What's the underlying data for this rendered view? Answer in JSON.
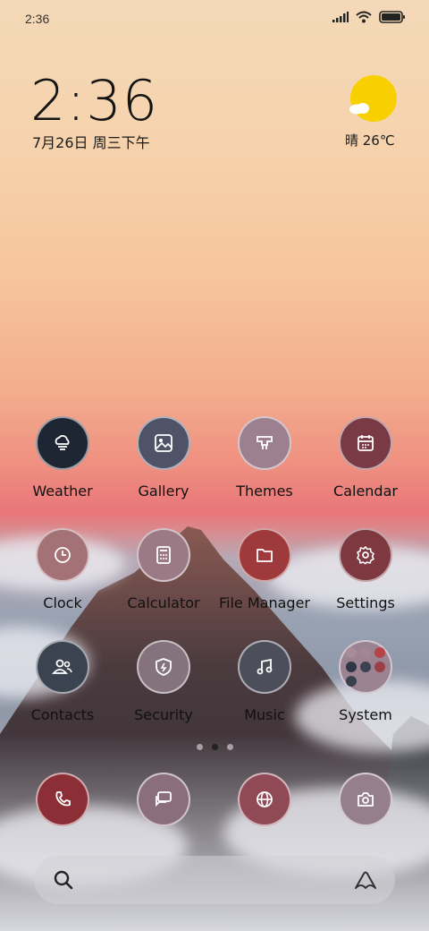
{
  "status_bar": {
    "time": "2:36"
  },
  "lock_widget": {
    "time": "2:36",
    "date": "7月26日 周三下午"
  },
  "weather_widget": {
    "text": "晴 26℃"
  },
  "apps": [
    {
      "label": "Weather",
      "icon": "weather-icon",
      "color": "#1f2633"
    },
    {
      "label": "Gallery",
      "icon": "gallery-icon",
      "color": "#4e5368"
    },
    {
      "label": "Themes",
      "icon": "themes-icon",
      "color": "#9d8090"
    },
    {
      "label": "Calendar",
      "icon": "calendar-icon",
      "color": "#7a3a45"
    },
    {
      "label": "Clock",
      "icon": "clock-icon",
      "color": "#a47276"
    },
    {
      "label": "Calculator",
      "icon": "calculator-icon",
      "color": "#9b7a86"
    },
    {
      "label": "File Manager",
      "icon": "folder-icon",
      "color": "#9e3a3c"
    },
    {
      "label": "Settings",
      "icon": "gear-icon",
      "color": "#7d3840"
    },
    {
      "label": "Contacts",
      "icon": "contacts-icon",
      "color": "#3b4250"
    },
    {
      "label": "Security",
      "icon": "security-icon",
      "color": "#84727d"
    },
    {
      "label": "Music",
      "icon": "music-icon",
      "color": "#4c4e5a"
    },
    {
      "label": "System",
      "icon": "system-folder-icon",
      "color": "#9b8392"
    }
  ],
  "dock": [
    {
      "icon": "phone-icon",
      "color": "#8b2e36"
    },
    {
      "icon": "messages-icon",
      "color": "#8a6e7c"
    },
    {
      "icon": "browser-icon",
      "color": "#8f4a56"
    },
    {
      "icon": "camera-icon",
      "color": "#967f8c"
    }
  ],
  "page_indicator": {
    "count": 3,
    "active": 1
  }
}
